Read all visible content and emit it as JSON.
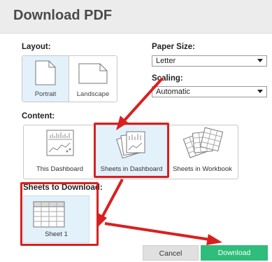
{
  "dialog": {
    "title": "Download PDF"
  },
  "layout": {
    "label": "Layout:",
    "options": [
      "Portrait",
      "Landscape"
    ],
    "selected": "Portrait"
  },
  "paper_size": {
    "label": "Paper Size:",
    "value": "Letter"
  },
  "scaling": {
    "label": "Scaling:",
    "value": "Automatic"
  },
  "content": {
    "label": "Content:",
    "options": [
      "This Dashboard",
      "Sheets in Dashboard",
      "Sheets in Workbook"
    ],
    "selected": "Sheets in Dashboard"
  },
  "sheets_to_download": {
    "label": "Sheets to Download:",
    "items": [
      "Sheet 1"
    ]
  },
  "buttons": {
    "cancel": "Cancel",
    "download": "Download"
  },
  "colors": {
    "accent_selected": "#e3f1fb",
    "download_button": "#2ebd7a",
    "annotation_red": "#d92020"
  }
}
